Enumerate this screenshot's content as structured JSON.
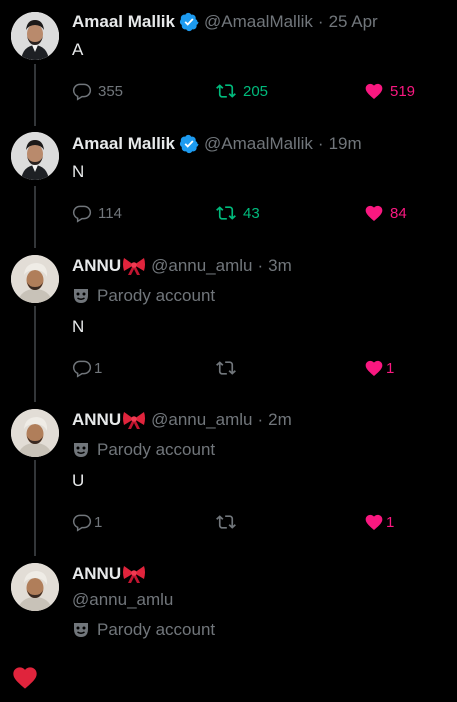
{
  "colors": {
    "background": "#000000",
    "text": "#e7e9ea",
    "muted": "#71767b",
    "retweet_green": "#00ba7c",
    "like_pink": "#f91880",
    "verified_blue": "#1d9bf0",
    "thread_line": "#333639"
  },
  "tweets": [
    {
      "author": "Amaal Mallik",
      "verified": true,
      "handle": "@AmaalMallik",
      "separator": "·",
      "time": "25 Apr",
      "text": "A",
      "replies": "355",
      "retweets": "205",
      "likes": "519"
    },
    {
      "author": "Amaal Mallik",
      "verified": true,
      "handle": "@AmaalMallik",
      "separator": "·",
      "time": "19m",
      "text": "N",
      "replies": "114",
      "retweets": "43",
      "likes": "84"
    },
    {
      "author": "ANNU",
      "handle": "@annu_amlu",
      "separator": "·",
      "time": "3m",
      "label": "Parody account",
      "text": "N",
      "replies": "1",
      "likes": "1"
    },
    {
      "author": "ANNU",
      "handle": "@annu_amlu",
      "separator": "·",
      "time": "2m",
      "label": "Parody account",
      "text": "U",
      "replies": "1",
      "likes": "1"
    },
    {
      "author": "ANNU",
      "handle": "@annu_amlu",
      "label": "Parody account"
    }
  ],
  "icons": {
    "reply": "speech-bubble-icon",
    "retweet": "retweet-arrows-icon",
    "like": "heart-icon",
    "verified": "verified-badge-icon",
    "bow": "ribbon-bow-emoji",
    "parody": "theater-mask-icon"
  }
}
